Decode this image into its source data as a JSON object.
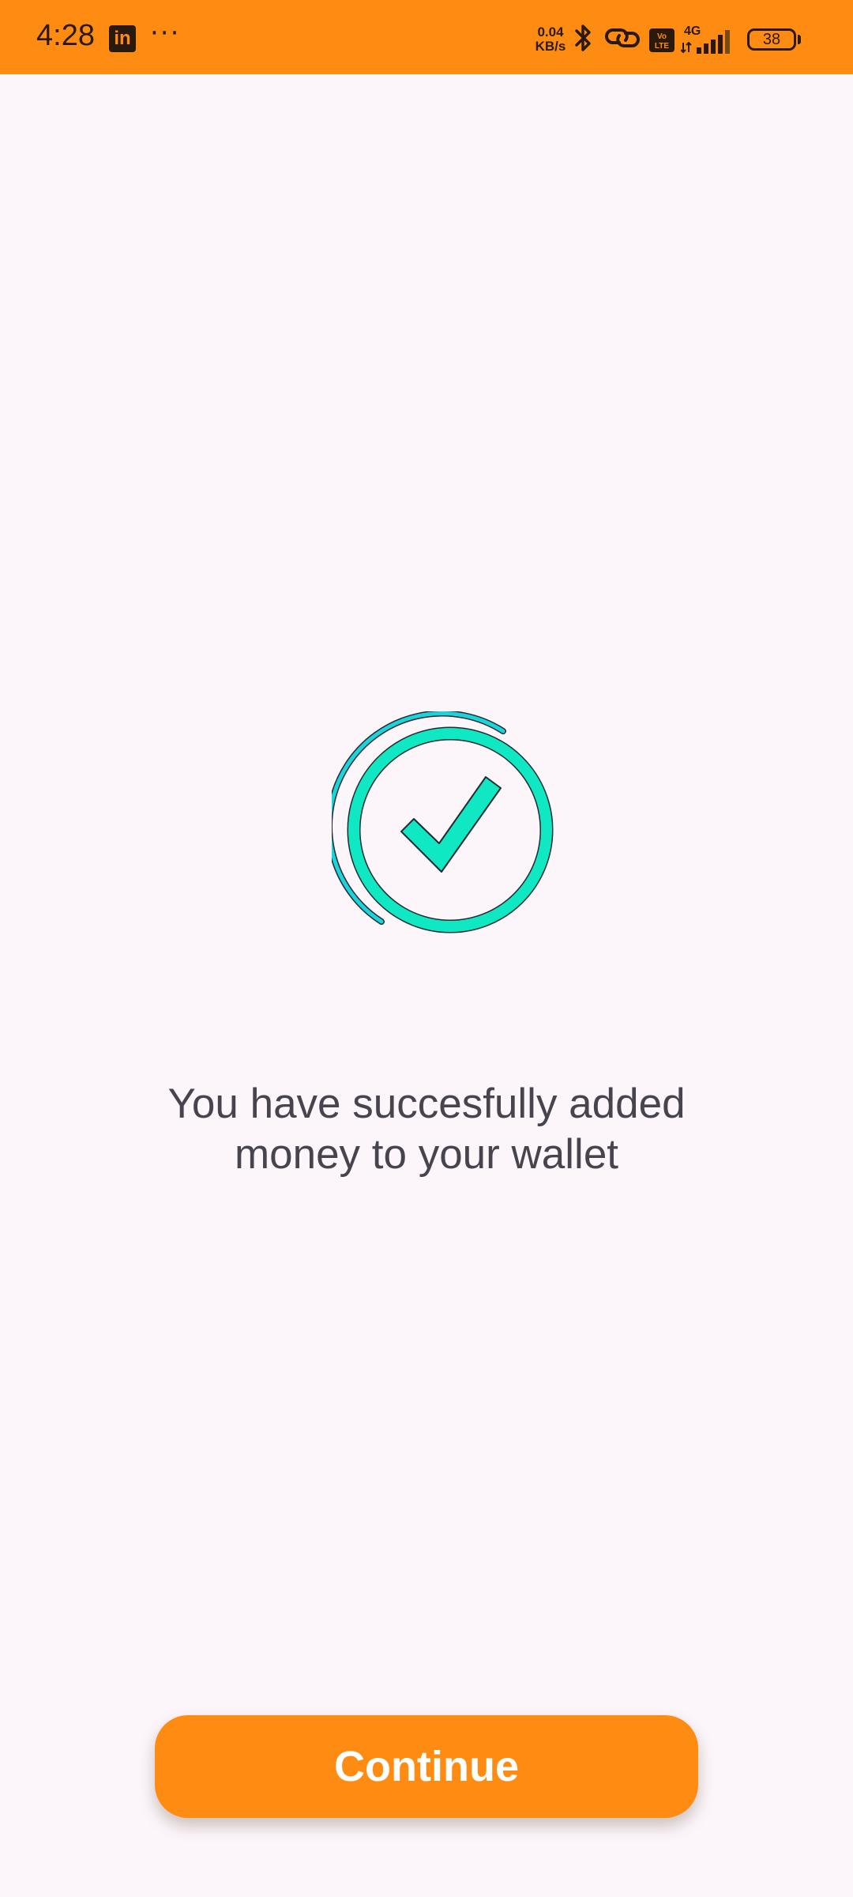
{
  "status_bar": {
    "time": "4:28",
    "linkedin_label": "in",
    "more": "···",
    "net_speed_value": "0.04",
    "net_speed_unit": "KB/s",
    "network_type": "4G",
    "volte_label": "Vo LTE",
    "battery_level": "38",
    "background_color": "#ff8c12"
  },
  "icons": {
    "success": "check-circle-icon",
    "bluetooth": "bluetooth-icon",
    "link": "link-icon",
    "signal": "signal-icon"
  },
  "success": {
    "message_line1": "You have succesfully added",
    "message_line2": "money to your wallet",
    "accent_color": "#10e8c4"
  },
  "actions": {
    "continue_label": "Continue",
    "button_color": "#ff8c12"
  }
}
